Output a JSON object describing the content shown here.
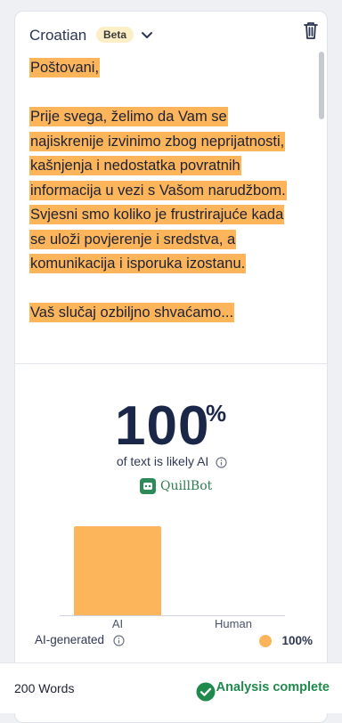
{
  "header": {
    "language": "Croatian",
    "badge": "Beta"
  },
  "text": {
    "p1": "Poštovani,",
    "p2a": "Prije svega, želimo da Vam se najiskrenije izvinimo zbog neprijatnosti, kašnjenja i nedostatka povratnih informacija u vezi s Vašom narudžbom.",
    "p2b": "Svjesni smo koliko je frustrirajuće kada se uloži povjerenje i sredstva, a komunikacija i isporuka izostanu.",
    "p3_partial": "Vaš slučaj ozbiljno shvaćamo..."
  },
  "result": {
    "score": "100",
    "percent_sign": "%",
    "caption": "of text is likely AI",
    "brand": "QuillBot"
  },
  "chart_data": {
    "type": "bar",
    "categories": [
      "AI",
      "Human"
    ],
    "values": [
      100,
      0
    ],
    "ylim": [
      0,
      100
    ],
    "colors": [
      "#fdb55c",
      "#fdb55c"
    ]
  },
  "legend": {
    "label": "AI-generated",
    "value": "100%"
  },
  "footer": {
    "word_count": "200 Words",
    "status": "Analysis complete"
  },
  "colors": {
    "highlight": "#fdb55c",
    "success": "#1f8a4c",
    "heading": "#1b2748"
  }
}
